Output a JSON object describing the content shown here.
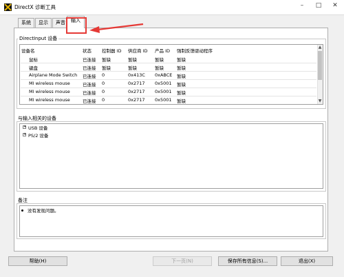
{
  "window": {
    "title": "DirectX 诊断工具",
    "buttons": [
      "–",
      "□",
      "✕"
    ]
  },
  "tabs": [
    {
      "label": "系统",
      "active": false
    },
    {
      "label": "显示",
      "active": false
    },
    {
      "label": "声音",
      "active": false
    },
    {
      "label": "输入",
      "active": true
    }
  ],
  "directinput": {
    "title": "DirectInput 设备",
    "columns": [
      "设备名",
      "状态",
      "控制器 ID",
      "供应商 ID",
      "产品 ID",
      "强制反馈驱动程序"
    ],
    "rows": [
      [
        "鼠标",
        "已连接",
        "暂缺",
        "暂缺",
        "暂缺",
        "暂缺"
      ],
      [
        "键盘",
        "已连接",
        "暂缺",
        "暂缺",
        "暂缺",
        "暂缺"
      ],
      [
        "Airplane Mode Switch",
        "已连接",
        "0",
        "0x413C",
        "0xABCE",
        "暂缺"
      ],
      [
        "MI wireless mouse",
        "已连接",
        "0",
        "0x2717",
        "0x5001",
        "暂缺"
      ],
      [
        "MI wireless mouse",
        "已连接",
        "0",
        "0x2717",
        "0x5001",
        "暂缺"
      ],
      [
        "MI wireless mouse",
        "已连接",
        "0",
        "0x2717",
        "0x5001",
        "暂缺"
      ]
    ]
  },
  "related": {
    "title": "与输入相关的设备",
    "items": [
      "USB 设备",
      "PS/2 设备"
    ]
  },
  "notes": {
    "title": "备注",
    "items": [
      "没有发现问题。"
    ]
  },
  "buttons": {
    "help": "帮助(H)",
    "next": "下一页(N)",
    "save": "保存所有信息(S)...",
    "exit": "退出(X)"
  },
  "colors": {
    "annotation": "#e53935",
    "window_bg": "#f0f0f0"
  }
}
